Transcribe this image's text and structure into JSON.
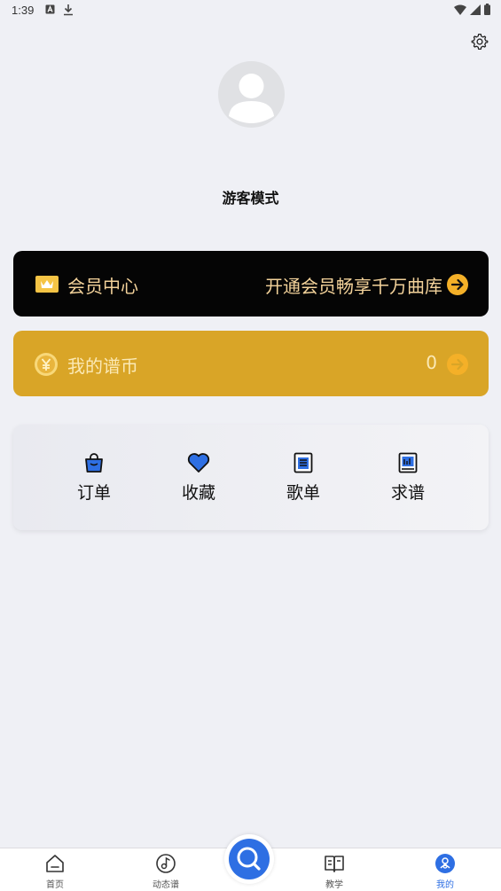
{
  "status_bar": {
    "time": "1:39"
  },
  "profile": {
    "username": "游客模式"
  },
  "vip": {
    "title": "会员中心",
    "promo": "开通会员畅享千万曲库"
  },
  "coins": {
    "title": "我的谱币",
    "value": "0"
  },
  "shortcuts": [
    {
      "label": "订单",
      "icon": "shopping-bag-icon"
    },
    {
      "label": "收藏",
      "icon": "heart-icon"
    },
    {
      "label": "歌单",
      "icon": "playlist-icon"
    },
    {
      "label": "求谱",
      "icon": "request-score-icon"
    }
  ],
  "tabbar": {
    "items": [
      {
        "label": "首页",
        "icon": "home-icon"
      },
      {
        "label": "动态谱",
        "icon": "music-disc-icon"
      },
      {
        "label": "教学",
        "icon": "book-icon"
      },
      {
        "label": "我的",
        "icon": "profile-icon"
      }
    ],
    "search_icon": "search-icon"
  },
  "colors": {
    "accent": "#2e6fe3",
    "vip_bg": "#050505",
    "vip_text": "#f3d29a",
    "coin_bg": "#d9a527",
    "arrow_orange": "#f4b028"
  }
}
